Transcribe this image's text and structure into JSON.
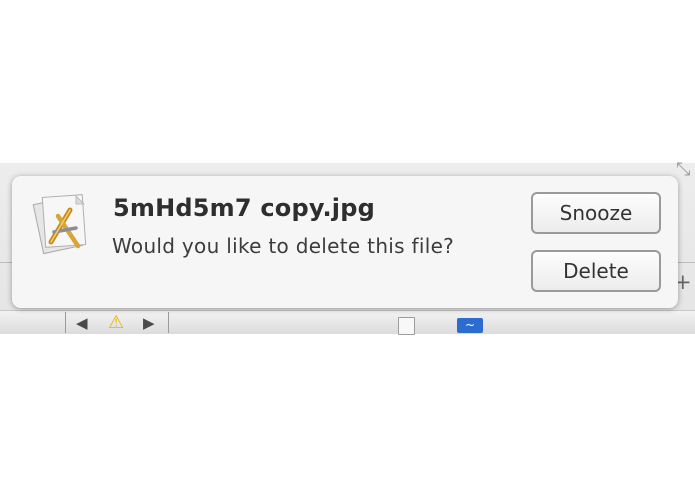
{
  "notification": {
    "title": "5mHd5m7 copy.jpg",
    "message": "Would you like to delete this file?",
    "icon": "app-icon",
    "buttons": {
      "snooze_label": "Snooze",
      "delete_label": "Delete"
    }
  },
  "background_window": {
    "icons": [
      "nav-back-icon",
      "warning-icon",
      "nav-forward-icon",
      "document-icon",
      "wave-icon",
      "add-icon",
      "resize-icon"
    ],
    "colors": {
      "warning": "#e9b300",
      "accent": "#2c6cd0"
    }
  }
}
